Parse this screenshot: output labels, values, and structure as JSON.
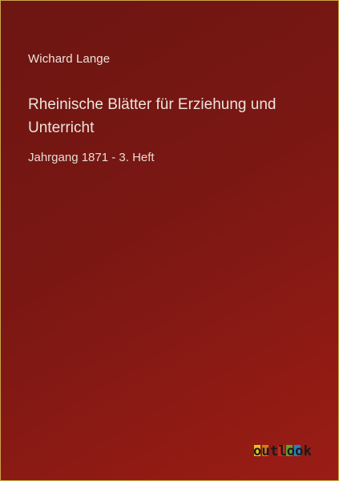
{
  "cover": {
    "author": "Wichard Lange",
    "title": "Rheinische Blätter für Erziehung und Unterricht",
    "subtitle": "Jahrgang 1871 - 3. Heft",
    "publisher_logo": "outlook"
  },
  "colors": {
    "background": "#7a1713",
    "border": "#c9a64a",
    "text": "#ece4dc",
    "logo_blocks": [
      "#e8c21d",
      "#d9781b",
      "#c32a20",
      "#62a12e",
      "#2d7fb8"
    ]
  }
}
